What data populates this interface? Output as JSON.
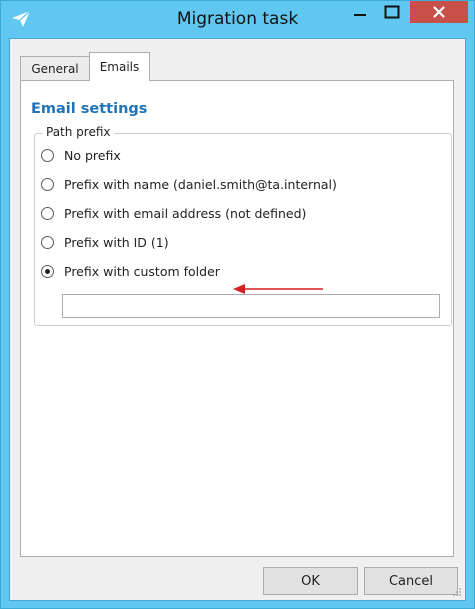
{
  "window": {
    "title": "Migration task",
    "controls": [
      "minimize",
      "maximize",
      "close"
    ]
  },
  "tabs": [
    {
      "label": "General",
      "active": false
    },
    {
      "label": "Emails",
      "active": true
    }
  ],
  "section": {
    "title": "Email settings",
    "group_label": "Path prefix",
    "options": [
      {
        "label": "No prefix",
        "checked": false
      },
      {
        "label": "Prefix with name (daniel.smith@ta.internal)",
        "checked": false
      },
      {
        "label": "Prefix with email address (not defined)",
        "checked": false
      },
      {
        "label": "Prefix with ID (1)",
        "checked": false
      },
      {
        "label": "Prefix with custom folder",
        "checked": true
      }
    ],
    "custom_folder_value": ""
  },
  "buttons": {
    "ok": "OK",
    "cancel": "Cancel"
  },
  "colors": {
    "titlebar": "#5fc7f0",
    "close": "#c7504a",
    "section_title": "#1f73b8",
    "annotation_arrow": "#d42020"
  }
}
